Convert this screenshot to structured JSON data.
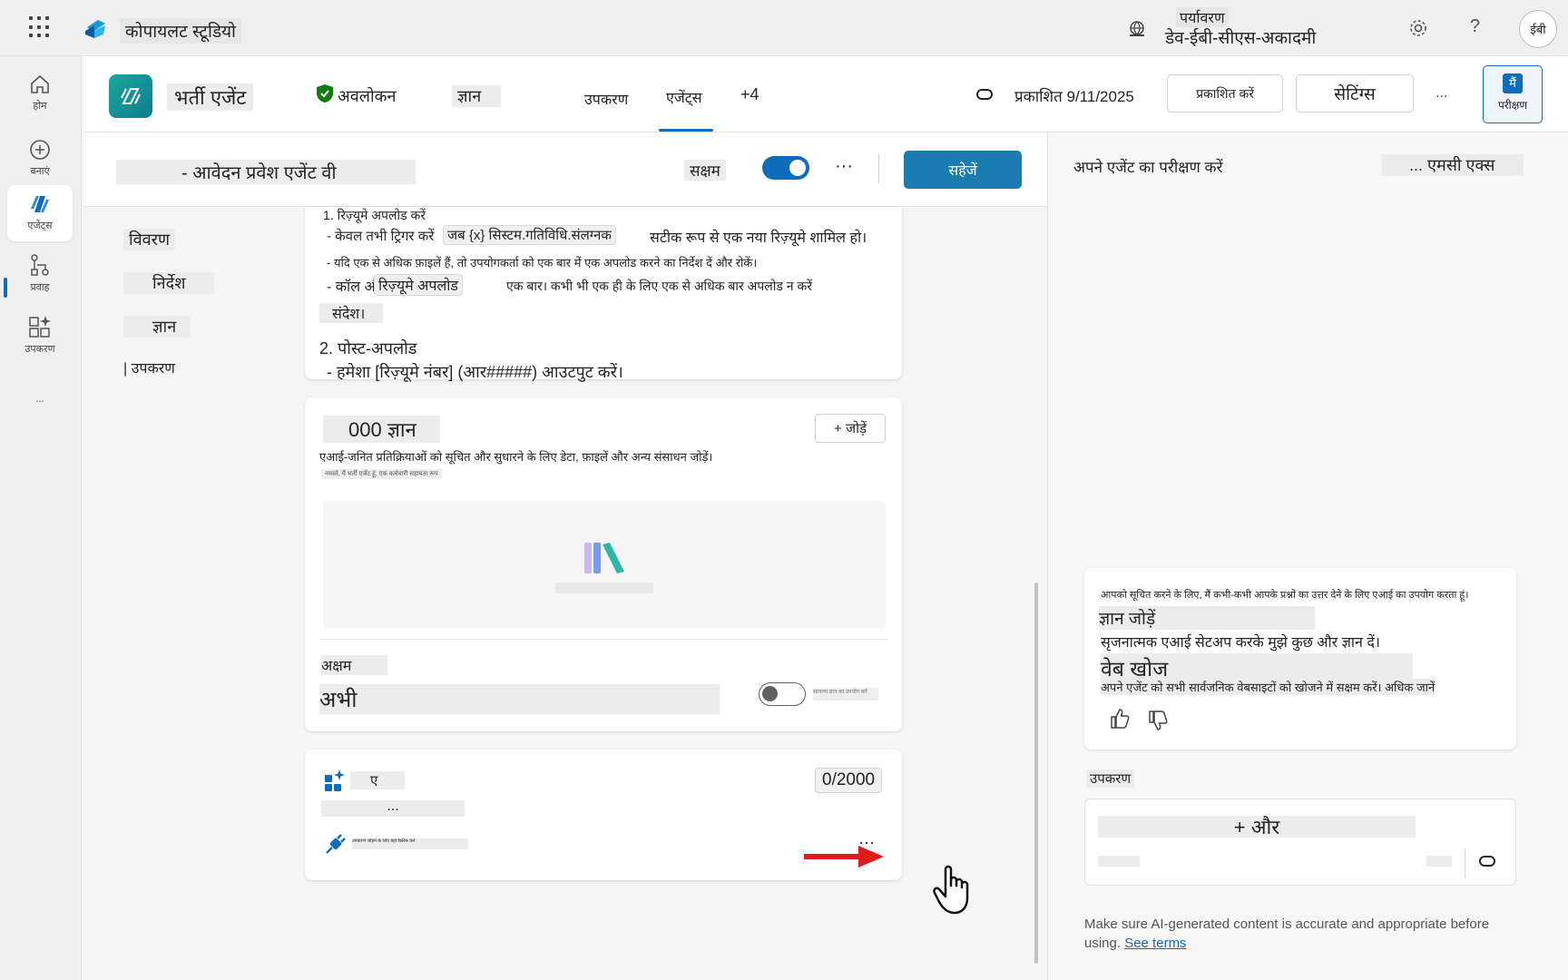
{
  "app": {
    "name": "कोपायलट स्टूडियो"
  },
  "environment": {
    "label": "पर्यावरण",
    "value": "डेव-ईबी-सीएस-अकादमी"
  },
  "user": {
    "initials": "ईबी"
  },
  "rail": [
    {
      "label": "होम",
      "icon": "home-icon"
    },
    {
      "label": "बनाएं",
      "icon": "plus-circle-icon"
    },
    {
      "label": "एजेंट्स",
      "icon": "agents-icon"
    },
    {
      "label": "प्रवाह",
      "icon": "flow-icon"
    },
    {
      "label": "उपकरण",
      "icon": "tools-icon"
    },
    {
      "label": "..."
    }
  ],
  "agent": {
    "name": "भर्ती एजेंट",
    "tabs": [
      "अवलोकन",
      "ज्ञान",
      "उपकरण",
      "एजेंट्स",
      "+4"
    ],
    "published": "प्रकाशित 9/11/2025",
    "publish_btn": "प्रकाशित करें",
    "settings_btn": "सेटिंग्स",
    "more": "...",
    "test_btn_icon": "मैं",
    "test_btn": "परीक्षण"
  },
  "editor": {
    "title": "- आवेदन प्रवेश एजेंट वी",
    "enabled": "सक्षम",
    "more": "···",
    "save": "सहेजें"
  },
  "sections": [
    "विवरण",
    "निर्देश",
    "ज्ञान",
    "| उपकरण"
  ],
  "instructions": {
    "l1": "1. रिज़्यूमे अपलोड करें",
    "l2a": "- केवल तभी ट्रिगर करें",
    "l2chip": "जब {x} सिस्टम.गतिविधि.संलग्नक",
    "l2b": "सटीक रूप से एक नया रिज़्यूमे शामिल हो।",
    "l3": "- यदि एक से अधिक फ़ाइलें हैं, तो उपयोगकर्ता को एक बार में एक अपलोड करने का निर्देश दें और रोकें।",
    "l4a": "- कॉल और",
    "l4chip": "रिज़्यूमे अपलोड",
    "l4b": "एक बार। कभी भी एक ही के लिए एक से अधिक बार अपलोड न करें",
    "l5": "संदेश।",
    "l6": "2. पोस्ट-अपलोड",
    "l7": "- हमेशा [रिज़्यूमे नंबर] (आर#####) आउटपुट करें।"
  },
  "knowledge": {
    "title": "000 ज्ञान",
    "add": "+ जोड़ें",
    "desc": "एआई-जनित प्रतिक्रियाओं को सूचित और सुधारने के लिए डेटा, फ़ाइलें और अन्य संसाधन जोड़ें।",
    "small": "नमस्ते, मैं भर्ती एजेंट हूं, एक कर्मचारी सहायता रूप",
    "disabled_label": "अक्षम",
    "now_label": "अभी",
    "toggle_note": "सामान्य ज्ञान का उपयोग करें"
  },
  "tools_card": {
    "label": "ए",
    "dots": "...",
    "counter": "0/2000",
    "line": "उपकरण जोड़ने के लिए यहां क्लिक करें",
    "more": "···"
  },
  "test_panel": {
    "title": "अपने एजेंट का परीक्षण करें",
    "mcs": "... एमसी एक्स",
    "msg_intro": "आपको सूचित करने के लिए, मैं कभी-कभी आपके प्रश्नों का उत्तर देने के लिए एआई का उपयोग करता हूं।",
    "add_knowledge": "ज्ञान जोड़ें",
    "add_knowledge_desc": "सृजनात्मक एआई सेटअप करके मुझे कुछ और ज्ञान दें।",
    "web_search": "वेब खोज",
    "web_search_desc": "अपने एजेंट को सभी सार्वजनिक वेबसाइटों को खोजने में सक्षम करें। अधिक जानें",
    "tools_label": "उपकरण",
    "more_btn": "+ और",
    "footer": "Make sure AI-generated content is accurate and appropriate before using.",
    "footer_link": "See terms"
  },
  "colors": {
    "accent": "#0f6cbd",
    "save": "#1a7cb0",
    "arrow": "#e01b1b",
    "shield": "#107c10"
  }
}
